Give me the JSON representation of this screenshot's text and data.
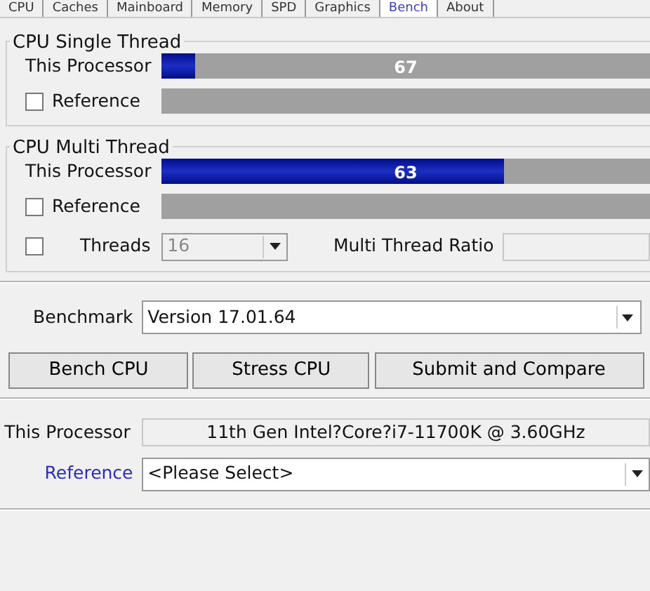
{
  "tabs": [
    {
      "label": "CPU",
      "selected": false
    },
    {
      "label": "Caches",
      "selected": false
    },
    {
      "label": "Mainboard",
      "selected": false
    },
    {
      "label": "Memory",
      "selected": false
    },
    {
      "label": "SPD",
      "selected": false
    },
    {
      "label": "Graphics",
      "selected": false
    },
    {
      "label": "Bench",
      "selected": true
    },
    {
      "label": "About",
      "selected": false
    }
  ],
  "single_thread": {
    "title": "CPU Single Thread",
    "this_processor": {
      "label": "This Processor",
      "level": 0.07,
      "score": "67"
    },
    "reference": {
      "label": "Reference",
      "checked": false
    }
  },
  "multi_thread": {
    "title": "CPU Multi Thread",
    "this_processor": {
      "label": "This Processor",
      "level": 0.7,
      "score": "63"
    },
    "reference": {
      "label": "Reference",
      "checked": false
    },
    "threads": {
      "checked": false,
      "label": "Threads",
      "value": "16",
      "disabled": true
    },
    "ratio_label": "Multi Thread Ratio"
  },
  "benchmark": {
    "label": "Benchmark",
    "value": "Version 17.01.64"
  },
  "buttons": [
    "Bench CPU",
    "Stress CPU",
    "Submit and Compare"
  ],
  "processor": {
    "label": "This Processor",
    "value": "11th Gen Intel?Core?i7-11700K @ 3.60GHz"
  },
  "reference": {
    "label": "Reference",
    "value": "<Please Select>"
  }
}
